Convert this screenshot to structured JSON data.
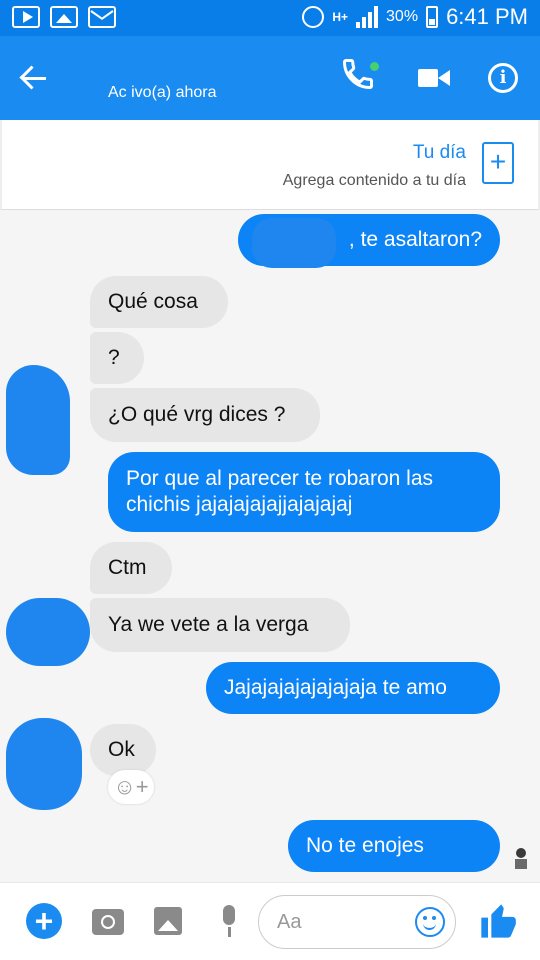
{
  "status_bar": {
    "network": "H+",
    "battery_percent": "30%",
    "time": "6:41 PM"
  },
  "header": {
    "status": "Ac ivo(a) ahora"
  },
  "tu_dia": {
    "title": "Tu día",
    "subtitle": "Agrega contenido a tu día",
    "add_label": "+"
  },
  "messages": [
    {
      "from": "me",
      "text": ", te asaltaron?"
    },
    {
      "from": "them",
      "text": "Qué cosa"
    },
    {
      "from": "them",
      "text": "?"
    },
    {
      "from": "them",
      "text": "¿O qué vrg dices ?"
    },
    {
      "from": "me",
      "text": "Por que al parecer te robaron las chichis jajajajajajjajajajaj"
    },
    {
      "from": "them",
      "text": "Ctm"
    },
    {
      "from": "them",
      "text": "Ya we vete a la verga"
    },
    {
      "from": "me",
      "text": "Jajajajajajajajaja te amo"
    },
    {
      "from": "them",
      "text": "Ok"
    },
    {
      "from": "me",
      "text": "No te enojes"
    }
  ],
  "reaction_label": "☺+",
  "composer": {
    "plus_label": "+",
    "placeholder": "Aa"
  },
  "colors": {
    "header": "#1a8bf0",
    "outgoing_bubble": "#0d84f5",
    "incoming_bubble": "#e6e6e6",
    "online_dot": "#45d16e"
  }
}
